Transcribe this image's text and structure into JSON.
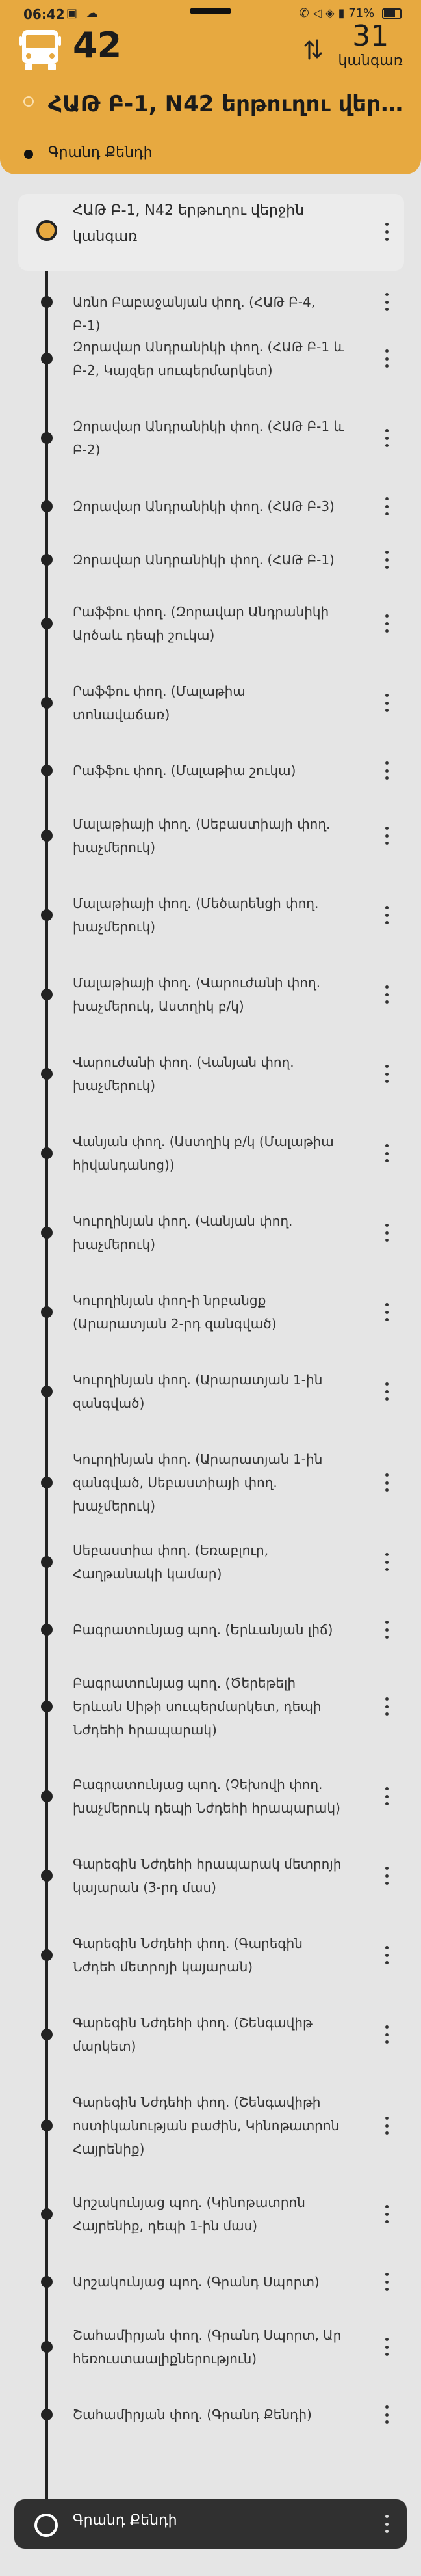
{
  "status_bar": {
    "time": "06:42",
    "battery": "71%"
  },
  "header": {
    "route_number": "42",
    "stops_count": "31",
    "stops_label": "կանգառ",
    "title": "ՀԱԹ Բ-1, N42 երթուղու վերջին կանգառ",
    "destination": "Գրանդ Քենդի"
  },
  "first_stop": "ՀԱԹ Բ-1, N42 երթուղու վերջին կանգառ",
  "stops": [
    "Առնո Բաբաջանյան փող. (ՀԱԹ Բ-4, Բ-1)",
    "Զորավար Անդրանիկի փող. (ՀԱԹ Բ-1 և Բ-2, Կայզեր սուպերմարկետ)",
    "Զորավար Անդրանիկի փող. (ՀԱԹ Բ-1 և Բ-2)",
    "Զորավար Անդրանիկի փող. (ՀԱԹ Բ-3)",
    "Զորավար Անդրանիկի փող. (ՀԱԹ Բ-1)",
    "Րաֆֆու փող. (Զորավար Անդրանիկի Արծաև դեպի շուկա)",
    "Րաֆֆու փող. (Մալաթիա տոնավաճառ)",
    "Րաֆֆու փող. (Մալաթիա շուկա)",
    "Մալաթիայի փող. (Սեբաստիայի փող. խաչմերուկ)",
    "Մալաթիայի փող. (Մեծարենցի փող. խաչմերուկ)",
    "Մալաթիայի փող. (Վարուժանի փող. խաչմերուկ, Աստղիկ բ/կ)",
    "Վարուժանի փող. (Վանյան փող. խաչմերուկ)",
    "Վանյան փող. (Աստղիկ բ/կ (Մալաթիա հիվանդանոց))",
    "Կուրղինյան փող. (Վանյան փող. խաչմերուկ)",
    "Կուրղինյան փող-ի նրբանցք (Արարատյան 2-րդ զանգված)",
    "Կուրղինյան փող. (Արարատյան 1-ին զանգված)",
    "Կուրղինյան փող. (Արարատյան 1-ին զանգված, Սեբաստիայի փող. խաչմերուկ)",
    "Սեբաստիա փող. (Եռաբլուր, Հաղթանակի կամար)",
    "Բագրատունյաց պող. (Երևանյան լիճ)",
    "Բագրատունյաց պող. (Ծերեթելի Երևան Սիթի սուպերմարկետ, դեպի Նժդեհի հրապարակ)",
    "Բագրատունյաց պող. (Չեխովի փող. խաչմերուկ դեպի Նժդեհի հրապարակ)",
    "Գարեգին Նժդեհի հրապարակ մետրոյի կայարան (3-րդ մաս)",
    "Գարեգին Նժդեհի փող. (Գարեգին Նժդեհ մետրոյի կայարան)",
    "Գարեգին Նժդեհի փող. (Շենգավիթ մարկետ)",
    "Գարեգին Նժդեհի փող. (Շենգավիթի ոստիկանության բաժին, Կինոթատրոն Հայրենիք)",
    "Արշակունյաց պող. (Կինոթատրոն Հայրենիք, դեպի 1-ին մաս)",
    "Արշակունյաց պող. (Գրանդ Սպորտ)",
    "Շահամիրյան փող. (Գրանդ Սպորտ, Ար հեռուստաալիքներություն)",
    "Շահամիրյան փող. (Գրանդ Քենդի)"
  ],
  "last_stop": "Գրանդ Քենդի"
}
